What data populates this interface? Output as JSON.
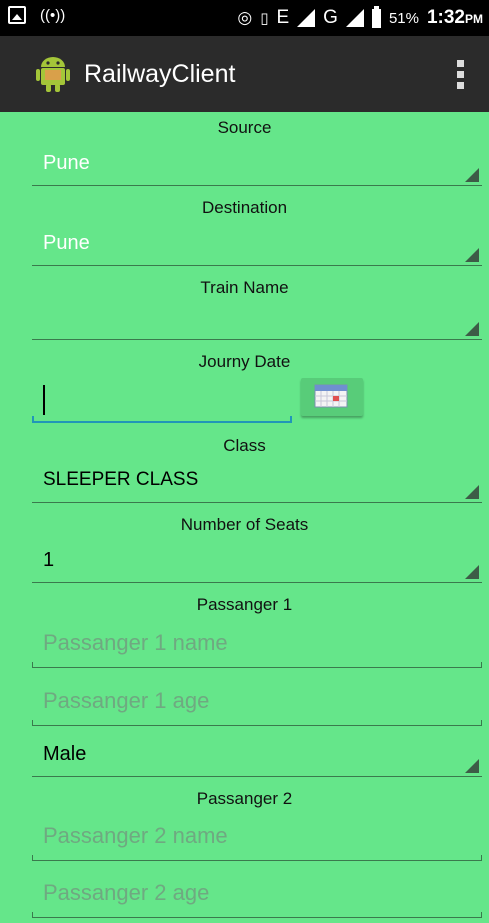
{
  "status_bar": {
    "battery_percent": "51%",
    "time": "1:32",
    "time_suffix": "PM",
    "network_label_1": "E",
    "network_label_2": "G"
  },
  "app_bar": {
    "title": "RailwayClient",
    "icon": "android-icon",
    "menu_icon": "overflow-menu-icon"
  },
  "form": {
    "source_label": "Source",
    "source_value": "Pune",
    "destination_label": "Destination",
    "destination_value": "Pune",
    "train_name_label": "Train Name",
    "train_name_value": "",
    "journey_date_label": "Journy Date",
    "journey_date_value": "",
    "class_label": "Class",
    "class_value": "SLEEPER CLASS",
    "seats_label": "Number of Seats",
    "seats_value": "1",
    "passenger1_label": "Passanger 1",
    "passenger1_name_placeholder": "Passanger 1 name",
    "passenger1_age_placeholder": "Passanger 1 age",
    "passenger1_gender": "Male",
    "passenger2_label": "Passanger 2",
    "passenger2_name_placeholder": "Passanger 2 name",
    "passenger2_age_placeholder": "Passanger 2 age"
  },
  "colors": {
    "background": "#65e68a",
    "action_bar": "#2b2b2b",
    "status_bar": "#000000",
    "focus_underline": "#2196b8"
  }
}
